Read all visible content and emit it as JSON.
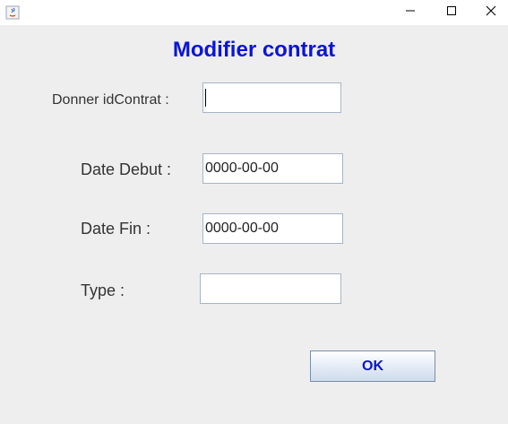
{
  "window": {
    "controls": {
      "minimize_icon": "minimize-icon",
      "maximize_icon": "maximize-icon",
      "close_icon": "close-icon"
    }
  },
  "form": {
    "title": "Modifier contrat",
    "id_label": "Donner idContrat :",
    "id_value": "",
    "date_debut_label": "Date Debut :",
    "date_debut_value": "0000-00-00",
    "date_fin_label": "Date Fin :",
    "date_fin_value": "0000-00-00",
    "type_label": "Type :",
    "type_value": "",
    "ok_label": "OK"
  },
  "colors": {
    "title": "#0a14d8",
    "button_text": "#0a14c8",
    "background": "#eeeeee"
  }
}
